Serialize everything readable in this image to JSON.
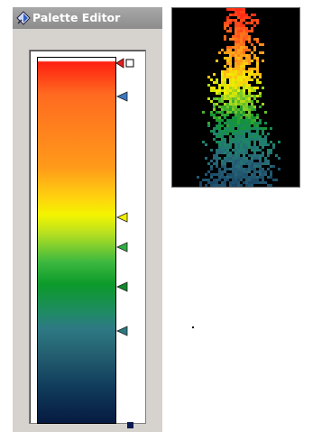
{
  "window": {
    "title": "Palette Editor"
  },
  "icons": {
    "title": "palette-icon",
    "marker": "triangle-marker-icon",
    "end": "end-square-icon"
  },
  "palette": {
    "markers": [
      {
        "name": "marker-red-white",
        "position": 0.01,
        "color": "#e02020"
      },
      {
        "name": "marker-orange-blue",
        "position": 0.1,
        "color": "#3a78c0"
      },
      {
        "name": "marker-yellow",
        "position": 0.43,
        "color": "#f0f000"
      },
      {
        "name": "marker-light-green",
        "position": 0.51,
        "color": "#30b040"
      },
      {
        "name": "marker-green",
        "position": 0.62,
        "color": "#108a2a"
      },
      {
        "name": "marker-teal",
        "position": 0.74,
        "color": "#2a7a80"
      }
    ],
    "end_color": "#0a1a50"
  },
  "colors": {
    "panel_bg": "#d6d3ce",
    "title_bg": "#999999",
    "preview_bg": "#000000"
  }
}
